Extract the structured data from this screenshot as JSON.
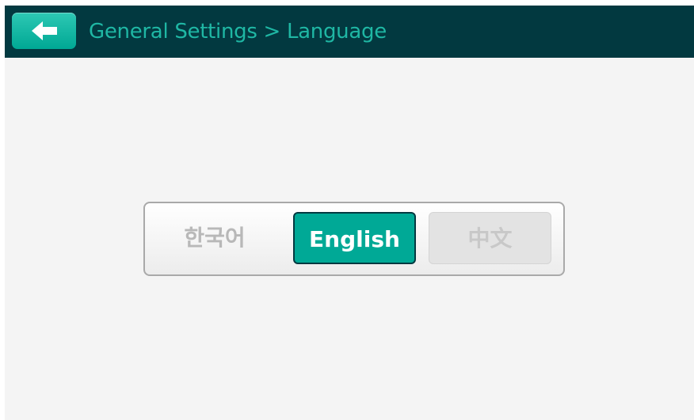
{
  "header": {
    "title": "General Settings > Language",
    "back_icon": "arrow-left-icon"
  },
  "language_selector": {
    "options": [
      {
        "label": "한국어",
        "state": "unselected"
      },
      {
        "label": "English",
        "state": "selected"
      },
      {
        "label": "中文",
        "state": "disabled"
      }
    ],
    "selected": "English"
  },
  "colors": {
    "header_bg": "#023940",
    "accent": "#00a996",
    "title_text": "#1fb7a4",
    "screen_bg": "#f4f4f4"
  }
}
